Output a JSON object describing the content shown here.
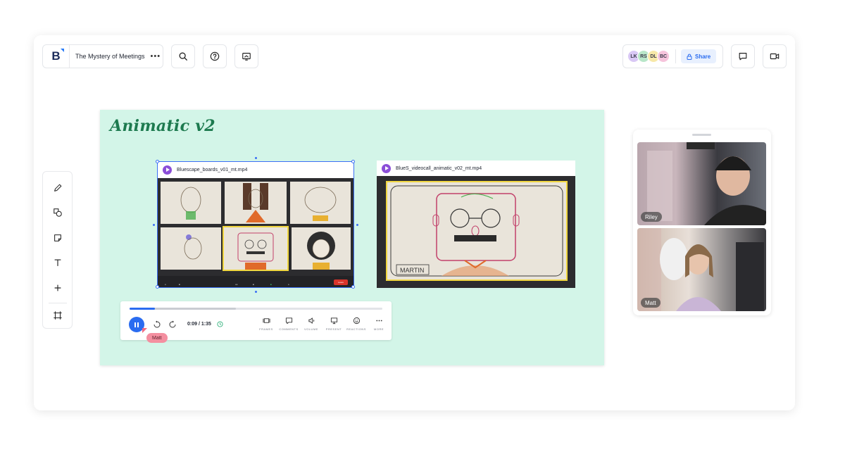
{
  "header": {
    "board_title": "The Mystery of Meetings",
    "more_glyph": "•••",
    "logo_letter": "B"
  },
  "collaborators": [
    {
      "initials": "LK",
      "color": "#d9c8f5"
    },
    {
      "initials": "RS",
      "color": "#b8e6c9"
    },
    {
      "initials": "DL",
      "color": "#f7e8a8"
    },
    {
      "initials": "BC",
      "color": "#f6c4dc"
    }
  ],
  "share": {
    "label": "Share"
  },
  "frame": {
    "title": "Animatic v2"
  },
  "videos": [
    {
      "file_name": "Bluescape_boards_v01_mt.mp4"
    },
    {
      "file_name": "BlueS_videocall_animatic_v02_mt.mp4"
    }
  ],
  "zoom_bar": {
    "leave_label": "Leave"
  },
  "drawing": {
    "name_tag": "MARTIN"
  },
  "player": {
    "current_time": "0:09",
    "duration": "1:35",
    "time_separator": " / ",
    "progress_fraction": 0.1,
    "buffer_fraction": 0.42,
    "controls": [
      "FRAMES",
      "COMMENTS",
      "VOLUME",
      "PRESENT",
      "REACTIONS",
      "MORE"
    ]
  },
  "cursor": {
    "user": "Matt"
  },
  "participants": [
    {
      "name": "Riley"
    },
    {
      "name": "Matt"
    }
  ],
  "colors": {
    "accent": "#2a6cf0",
    "frame_bg": "#d3f5e8",
    "frame_title": "#1d7a4f",
    "video_icon": "#8b4ed8",
    "cursor_tag": "#f48fa0"
  }
}
